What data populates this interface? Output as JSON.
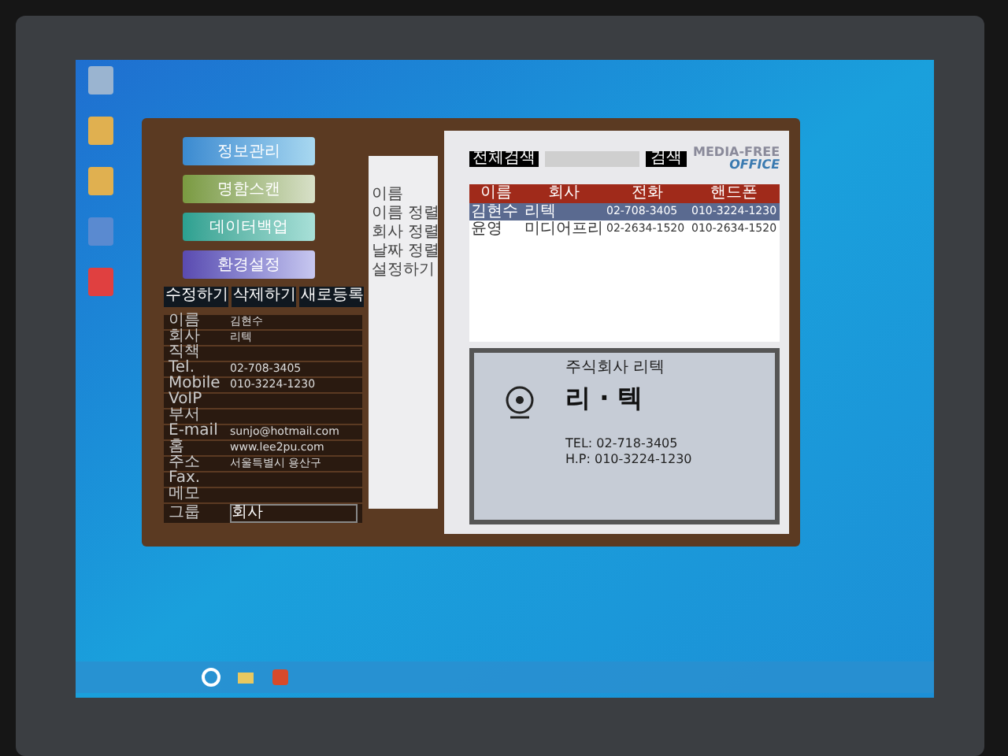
{
  "app": {
    "menu_buttons": [
      {
        "label": "정보관리"
      },
      {
        "label": "명함스캔"
      },
      {
        "label": "데이터백업"
      },
      {
        "label": "환경설정"
      }
    ],
    "sort_menu": [
      "이름",
      "이름 정렬",
      "회사 정렬",
      "날짜 정렬",
      "설정하기"
    ],
    "action_buttons": [
      "수정하기",
      "삭제하기",
      "새로등록"
    ],
    "fields": [
      {
        "label": "이름",
        "value": "김현수"
      },
      {
        "label": "회사",
        "value": "리텍"
      },
      {
        "label": "직책"
      },
      {
        "label": "Tel.",
        "value": "02-708-3405"
      },
      {
        "label": "Mobile",
        "value": "010-3224-1230"
      },
      {
        "label": "VoIP"
      },
      {
        "label": "부서"
      },
      {
        "label": "E-mail",
        "value": "sunjo@hotmail.com"
      },
      {
        "label": "홈",
        "value": "www.lee2pu.com"
      },
      {
        "label": "주소",
        "value": "서울특별시 용산구"
      },
      {
        "label": "Fax."
      },
      {
        "label": "메모"
      }
    ],
    "group": {
      "label": "그룹",
      "value": "회사"
    },
    "search": {
      "label": "전체검색",
      "button": "검색"
    },
    "logo": {
      "brand": "MEDIA-FREE",
      "product": "OFFICE"
    },
    "table": {
      "columns": [
        "이름",
        "회사",
        "전화",
        "핸드폰"
      ],
      "rows": [
        {
          "cells": [
            "김현수",
            "리텍",
            "02-708-3405",
            "010-3224-1230"
          ],
          "selected": true
        },
        {
          "cells": [
            "윤영",
            "미디어프리",
            "02-2634-1520",
            "010-2634-1520"
          ],
          "selected": false
        }
      ]
    },
    "card": {
      "title": "주식회사 리텍",
      "name": "리 · 텍",
      "lines": [
        "TEL: 02-718-3405",
        "H.P: 010-3224-1230"
      ]
    }
  }
}
